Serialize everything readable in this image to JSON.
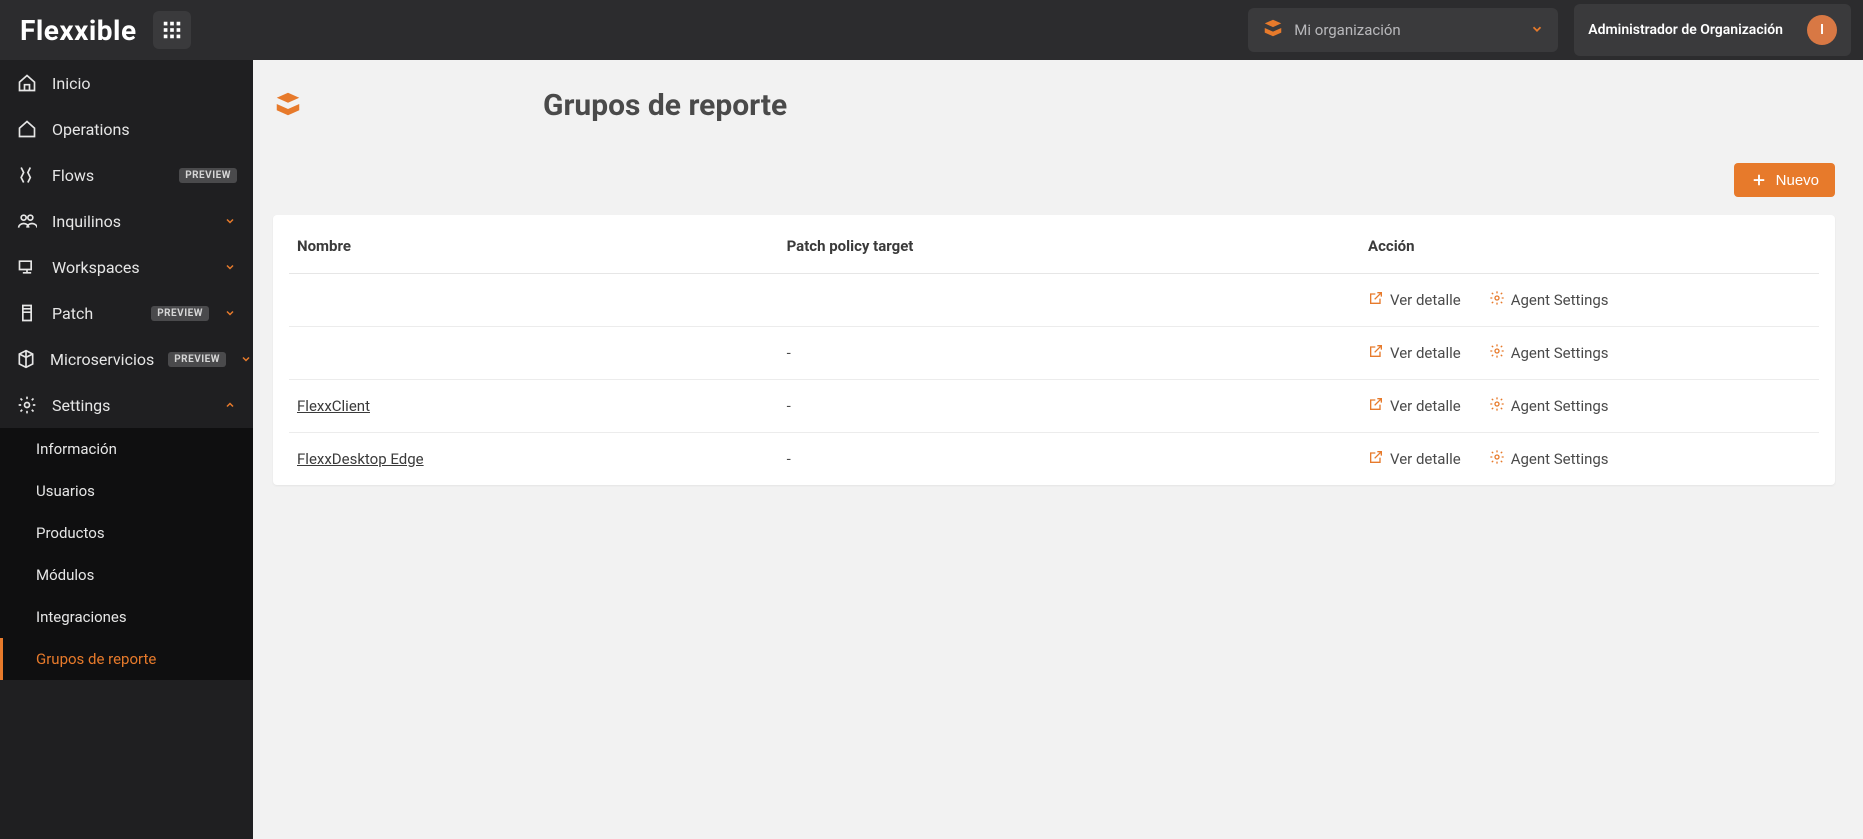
{
  "header": {
    "logo_text": "Flexxible",
    "org_text": "Mi organización",
    "role": "Administrador de Organización",
    "avatar_initial": "I"
  },
  "sidebar": {
    "items": [
      {
        "label": "Inicio"
      },
      {
        "label": "Operations"
      },
      {
        "label": "Flows",
        "badge": "PREVIEW"
      },
      {
        "label": "Inquilinos",
        "chev": true
      },
      {
        "label": "Workspaces",
        "chev": true
      },
      {
        "label": "Patch",
        "badge": "PREVIEW",
        "chev": true
      },
      {
        "label": "Microservicios",
        "badge": "PREVIEW",
        "chev": true
      },
      {
        "label": "Settings",
        "chev": true,
        "expanded": true
      }
    ],
    "settings_sub": [
      {
        "label": "Información"
      },
      {
        "label": "Usuarios"
      },
      {
        "label": "Productos"
      },
      {
        "label": "Módulos"
      },
      {
        "label": "Integraciones"
      },
      {
        "label": "Grupos de reporte",
        "active": true
      }
    ]
  },
  "page": {
    "title": "Grupos de reporte",
    "new_button": "Nuevo"
  },
  "table": {
    "columns": {
      "name": "Nombre",
      "target": "Patch policy target",
      "action": "Acción"
    },
    "rows": [
      {
        "name": "",
        "target": ""
      },
      {
        "name": "",
        "target": "-"
      },
      {
        "name": "FlexxClient",
        "target": "-"
      },
      {
        "name": "FlexxDesktop Edge",
        "target": "-"
      }
    ],
    "action_detail": "Ver detalle",
    "action_agent": "Agent Settings"
  }
}
